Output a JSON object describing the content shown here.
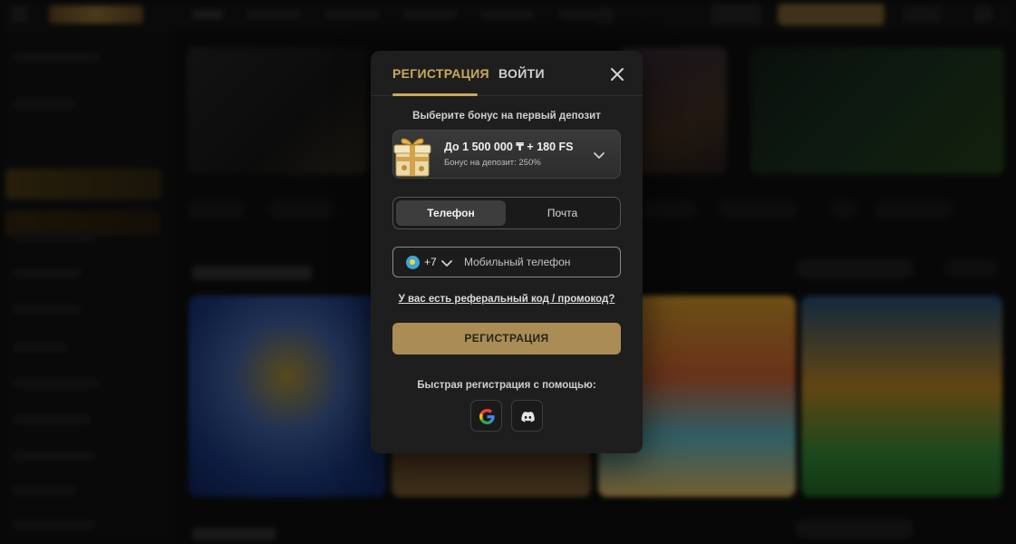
{
  "modal": {
    "tabs": {
      "register": "РЕГИСТРАЦИЯ",
      "login": "ВОЙТИ"
    },
    "bonus": {
      "heading": "Выберите бонус на первый депозит",
      "main": "До 1 500 000 ₸ + 180 FS",
      "sub": "Бонус на депозит: 250%"
    },
    "method_toggle": {
      "phone": "Телефон",
      "email": "Почта",
      "selected": "phone"
    },
    "phone_field": {
      "country_code": "+7",
      "placeholder": "Мобильный телефон",
      "value": ""
    },
    "promo_link": "У вас есть реферальный код / промокод?",
    "submit_label": "РЕГИСТРАЦИЯ",
    "quick_register": {
      "heading": "Быстрая регистрация с помощью:",
      "providers": [
        "google-icon",
        "discord-icon"
      ]
    }
  },
  "colors": {
    "accent": "#c9a95c",
    "button": "#a98d55",
    "modal_bg": "#1e1e1e"
  }
}
